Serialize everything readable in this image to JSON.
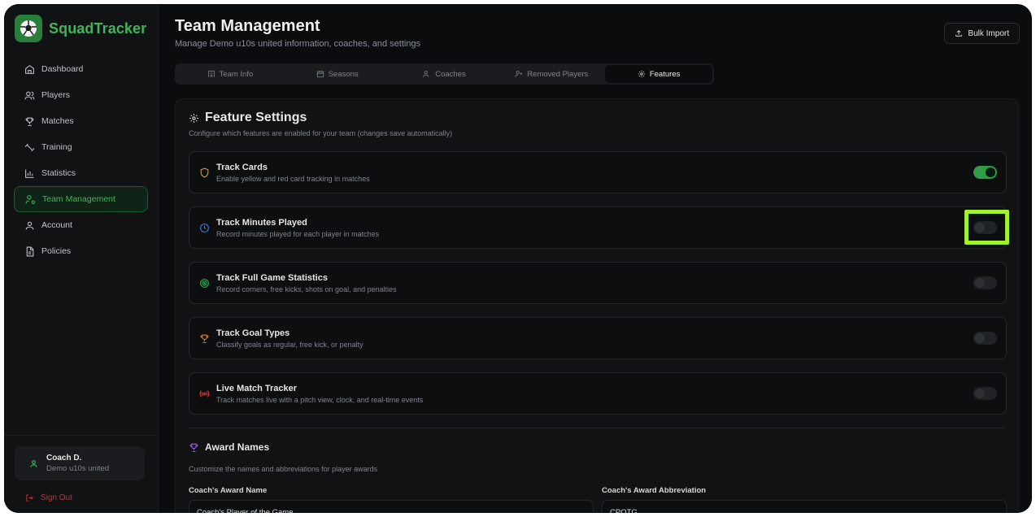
{
  "brand": {
    "name": "SquadTracker"
  },
  "sidebar": {
    "items": [
      {
        "label": "Dashboard",
        "icon": "home-icon"
      },
      {
        "label": "Players",
        "icon": "users-icon"
      },
      {
        "label": "Matches",
        "icon": "trophy-icon"
      },
      {
        "label": "Training",
        "icon": "dumbbell-icon"
      },
      {
        "label": "Statistics",
        "icon": "bar-chart-icon"
      },
      {
        "label": "Team Management",
        "icon": "user-cog-icon",
        "active": true
      },
      {
        "label": "Account",
        "icon": "user-icon"
      },
      {
        "label": "Policies",
        "icon": "file-icon"
      }
    ],
    "user": {
      "name": "Coach D.",
      "team": "Demo u10s united"
    },
    "signout": "Sign Out"
  },
  "header": {
    "title": "Team Management",
    "subtitle": "Manage Demo u10s united information, coaches, and settings",
    "bulk_import": "Bulk Import"
  },
  "tabs": [
    {
      "label": "Team Info"
    },
    {
      "label": "Seasons"
    },
    {
      "label": "Coaches"
    },
    {
      "label": "Removed Players"
    },
    {
      "label": "Features",
      "active": true
    }
  ],
  "features": {
    "title": "Feature Settings",
    "subtitle": "Configure which features are enabled for your team (changes save automatically)",
    "items": [
      {
        "name": "Track Cards",
        "desc": "Enable yellow and red card tracking in matches",
        "enabled": true,
        "icon": "shield-icon"
      },
      {
        "name": "Track Minutes Played",
        "desc": "Record minutes played for each player in matches",
        "enabled": false,
        "icon": "clock-icon"
      },
      {
        "name": "Track Full Game Statistics",
        "desc": "Record corners, free kicks, shots on goal, and penalties",
        "enabled": false,
        "icon": "target-icon"
      },
      {
        "name": "Track Goal Types",
        "desc": "Classify goals as regular, free kick, or penalty",
        "enabled": false,
        "icon": "trophy-icon"
      },
      {
        "name": "Live Match Tracker",
        "desc": "Track matches live with a pitch view, clock, and real-time events",
        "enabled": false,
        "icon": "broadcast-icon"
      }
    ]
  },
  "awards": {
    "title": "Award Names",
    "subtitle": "Customize the names and abbreviations for player awards",
    "name_label": "Coach's Award Name",
    "name_value": "Coach's Player of the Game",
    "abbr_label": "Coach's Award Abbreviation",
    "abbr_value": "CPOTG"
  },
  "colors": {
    "accent": "#3fb657",
    "highlight": "#a5f02e"
  }
}
